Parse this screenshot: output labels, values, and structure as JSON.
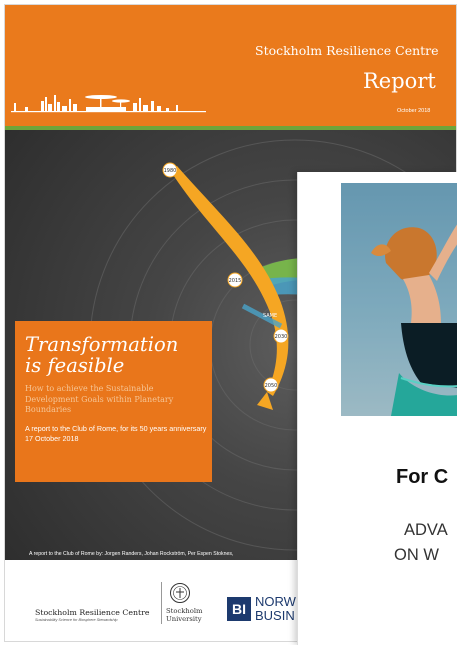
{
  "cover": {
    "org_name": "Stockholm Resilience Centre",
    "doc_type": "Report",
    "date": "October 2018",
    "title_line1": "Transformation",
    "title_line2": "is feasible",
    "subtitle": "How to achieve the Sustainable Development Goals within Planetary Boundaries",
    "report_note": "A report to the Club of Rome, for its 50 years anniversary 17 October 2018",
    "authors": "A report to the Club of Rome by: Jorgen Randers, Johan Rockström, Per Espen Stoknes,",
    "timeline_years": [
      "1980",
      "2015",
      "2030",
      "2050"
    ],
    "timeline_label": "SAME",
    "logos": {
      "src_name": "Stockholm Resilience Centre",
      "src_tagline": "Sustainability Science for Biosphere Stewardship",
      "su_name": "Stockholm University",
      "bi_mark": "BI",
      "bi_line1": "NORW",
      "bi_line2": "BUSIN"
    },
    "colors": {
      "orange": "#ea7a1c",
      "green": "#6fa43a",
      "navy": "#1d3a6e",
      "arrow": "#f5a623"
    }
  },
  "front": {
    "heading": "For C",
    "line1": "ADVA",
    "line2": "ON W"
  }
}
